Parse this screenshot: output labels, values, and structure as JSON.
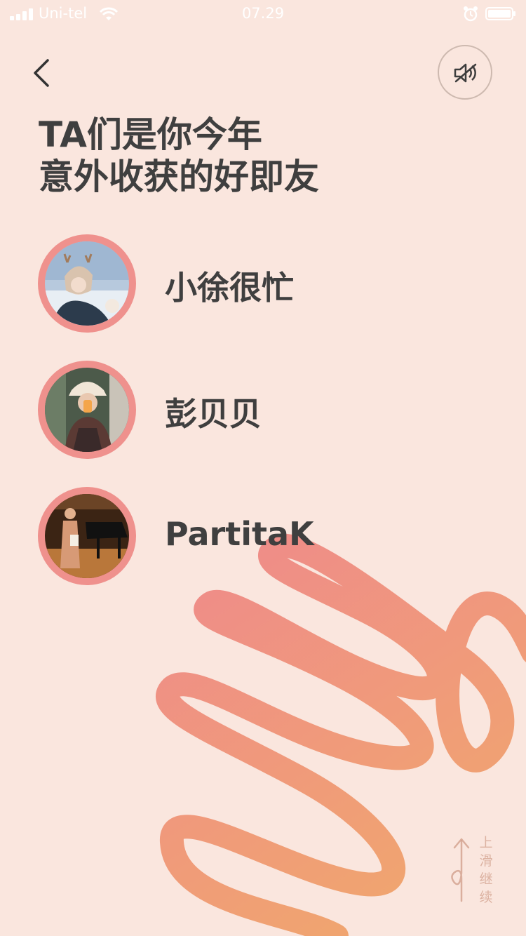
{
  "status_bar": {
    "carrier": "Uni-tel",
    "time": "07.29",
    "signal_icon": "signal-bars-icon",
    "wifi_icon": "wifi-icon",
    "alarm_icon": "alarm-clock-icon",
    "battery_icon": "battery-icon"
  },
  "header": {
    "back_icon": "chevron-left-icon",
    "sound_icon": "speaker-muted-icon"
  },
  "title": {
    "line1": "TA们是你今年",
    "line2": "意外收获的好即友"
  },
  "friends": [
    {
      "name": "小徐很忙"
    },
    {
      "name": "彭贝贝"
    },
    {
      "name": "PartitaK"
    }
  ],
  "swipe_hint": {
    "chars": [
      "上",
      "滑",
      "继",
      "续"
    ],
    "icon": "swipe-up-arrow-icon"
  },
  "colors": {
    "background": "#fae6de",
    "avatar_ring": "#ef918d",
    "squiggle_start": "#ef8a8b",
    "squiggle_end": "#f0a66e",
    "text": "#3f3f3f"
  }
}
